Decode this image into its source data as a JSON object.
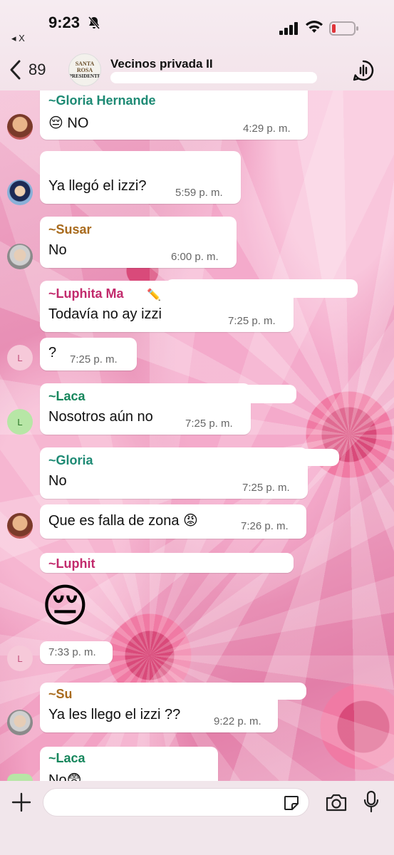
{
  "status_bar": {
    "time": "9:23",
    "back_app": "◂ X"
  },
  "header": {
    "back_count": "89",
    "avatar_line1": "SANTA",
    "avatar_line2": "ROSA",
    "avatar_line3": "PRESIDENTE",
    "title": "Vecinos privada II"
  },
  "messages": [
    {
      "sender": "~Gloria Hernande",
      "text": "😔 NO",
      "time": "4:29 p. m."
    },
    {
      "text": "Ya llegó el izzi?",
      "time": "5:59 p. m."
    },
    {
      "sender": "~Susar",
      "text": "No",
      "time": "6:00 p. m."
    },
    {
      "sender": "~Luphita Ma",
      "text": "Todavía no ay izzi",
      "time": "7:25 p. m."
    },
    {
      "text": "?",
      "time": "7:25 p. m.",
      "avatar_letter": "L"
    },
    {
      "sender": "~Laca",
      "text": "Nosotros aún no",
      "time": "7:25 p. m.",
      "avatar_letter": "L"
    },
    {
      "sender": "~Gloria",
      "text": "No",
      "time": "7:25 p. m."
    },
    {
      "text": "Que es falla de zona 😡",
      "time": "7:26 p. m."
    },
    {
      "sender": "~Luphit",
      "emoji": "😔",
      "time": "7:33 p. m.",
      "avatar_letter": "L"
    },
    {
      "sender": "~Su",
      "text": "Ya les llego el izzi ??",
      "time": "9:22 p. m."
    },
    {
      "sender": "~Laca",
      "text": "No😨"
    }
  ],
  "composer": {
    "placeholder": ""
  },
  "colors": {
    "gloria": "#1d8a74",
    "susana": "#a86a1c",
    "luphita": "#c22a6c",
    "laca": "#16865c",
    "avatar_l_pink": "#f6c9d9",
    "avatar_l_green": "#b7e6a6"
  }
}
